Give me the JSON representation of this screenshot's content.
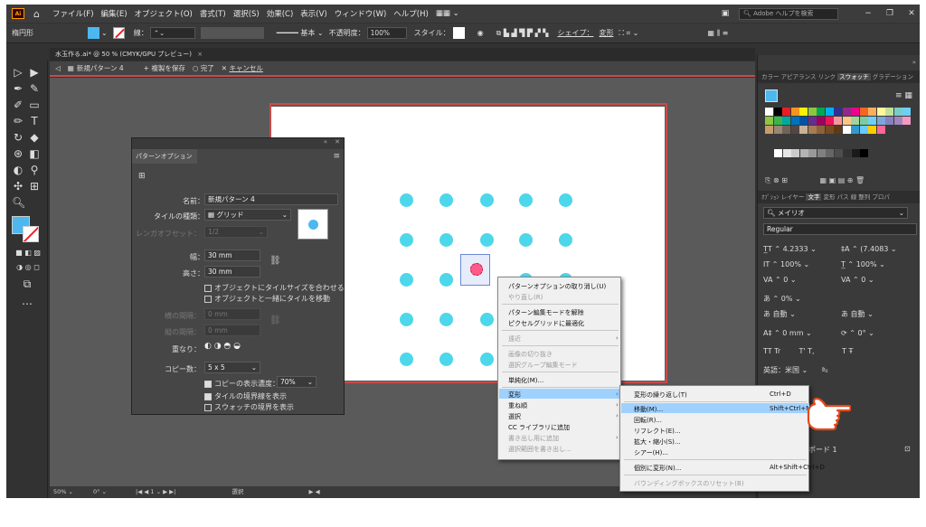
{
  "menubar": {
    "logo": "Ai",
    "items": [
      "ファイル(F)",
      "編集(E)",
      "オブジェクト(O)",
      "書式(T)",
      "選択(S)",
      "効果(C)",
      "表示(V)",
      "ウィンドウ(W)",
      "ヘルプ(H)"
    ],
    "search_placeholder": "Adobe ヘルプを検索"
  },
  "control_bar": {
    "object_type": "楕円形",
    "stroke_label": "線：",
    "stroke_style": "基本",
    "opacity_label": "不透明度：",
    "opacity_value": "100%",
    "style_label": "スタイル：",
    "shape_label": "シェイプ：",
    "transform_label": "変形"
  },
  "document_tab": {
    "title": "水玉作る.ai* @ 50 % (CMYK/GPU プレビュー)",
    "close": "×"
  },
  "edit_bar": {
    "pattern_name": "新規パターン 4",
    "save_copy": "+ 複製を保存",
    "done": "完了",
    "cancel": "キャンセル"
  },
  "pattern_options": {
    "tab": "パターンオプション",
    "name_label": "名前：",
    "name_value": "新規パターン 4",
    "tile_type_label": "タイルの種類：",
    "tile_type_value": "グリッド",
    "brick_offset_label": "レンガオフセット：",
    "brick_offset_value": "1/2",
    "width_label": "幅：",
    "width_value": "30 mm",
    "height_label": "高さ：",
    "height_value": "30 mm",
    "fit_tile": "オブジェクトにタイルサイズを合わせる",
    "move_tile": "オブジェクトと一緒にタイルを移動",
    "h_spacing_label": "横の間隔：",
    "h_spacing_value": "0 mm",
    "v_spacing_label": "縦の間隔：",
    "v_spacing_value": "0 mm",
    "overlap_label": "重なり：",
    "copies_label": "コピー数：",
    "copies_value": "5 x 5",
    "dim_copies_label": "コピーの表示濃度：",
    "dim_copies_value": "70%",
    "show_tile_edge": "タイルの境界線を表示",
    "show_swatch_bounds": "スウォッチの境界を表示"
  },
  "right_panel": {
    "tabs": [
      "カラー",
      "アピアランス",
      "リンク",
      "スウォッチ",
      "グラデーション"
    ],
    "char_tabs": [
      "ｵﾌﾟｼｮﾝ",
      "レイヤー",
      "文字",
      "変形",
      "パス",
      "線",
      "整列",
      "プロパ"
    ],
    "font": "メイリオ",
    "font_style": "Regular",
    "font_size": "4.2333",
    "leading": "(7.4083",
    "h_scale": "100%",
    "v_scale": "100%",
    "tracking": "0",
    "kerning": "0",
    "tsume": "0%",
    "auto1": "自動",
    "auto2": "自動",
    "baseline": "0 mm",
    "rotation": "0°",
    "language": "英語：米国",
    "artboard": "ボード 1"
  },
  "context_menu": {
    "items": [
      {
        "label": "パターンオプションの取り消し(U)"
      },
      {
        "label": "やり直し(R)"
      },
      {
        "label": "パターン編集モードを解除"
      },
      {
        "label": "ピクセルグリッドに最適化"
      },
      {
        "label": "遠近"
      },
      {
        "label": "画像の切り抜き"
      },
      {
        "label": "選択グループ編集モード"
      },
      {
        "label": "単純化(M)..."
      },
      {
        "label": "変形"
      },
      {
        "label": "重ね順"
      },
      {
        "label": "選択"
      },
      {
        "label": "CC ライブラリに追加"
      },
      {
        "label": "書き出し用に追加"
      },
      {
        "label": "選択範囲を書き出し..."
      }
    ]
  },
  "transform_submenu": {
    "items": [
      {
        "label": "変形の繰り返し(T)",
        "shortcut": "Ctrl+D"
      },
      {
        "label": "移動(M)...",
        "shortcut": "Shift+Ctrl+M"
      },
      {
        "label": "回転(R)...",
        "shortcut": ""
      },
      {
        "label": "リフレクト(E)...",
        "shortcut": ""
      },
      {
        "label": "拡大・縮小(S)...",
        "shortcut": ""
      },
      {
        "label": "シアー(H)...",
        "shortcut": ""
      },
      {
        "label": "個別に変形(N)...",
        "shortcut": "Alt+Shift+Ctrl+D"
      },
      {
        "label": "バウンディングボックスのリセット(B)",
        "shortcut": ""
      }
    ]
  },
  "status_bar": {
    "zoom": "50%",
    "rotation": "0°",
    "page": "1",
    "tool": "選択"
  },
  "colors": {
    "dot": "#4dd7ea",
    "highlight": "#9fd1ff",
    "edit_border": "#c94b4b",
    "fill": "#4db8f0"
  }
}
